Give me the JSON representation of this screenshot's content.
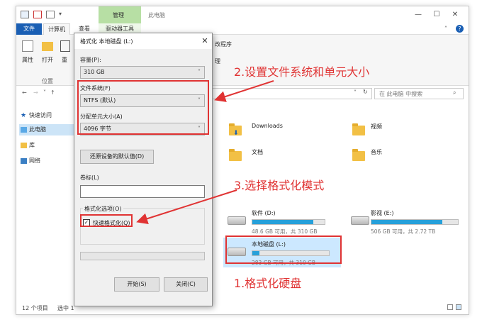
{
  "window": {
    "title": "此电脑",
    "context_tab_group": "管理",
    "controls": {
      "minimize": "—",
      "maximize": "☐",
      "close": "✕"
    }
  },
  "ribbon": {
    "tabs": [
      {
        "label": "文件"
      },
      {
        "label": "计算机"
      },
      {
        "label": "查看"
      },
      {
        "label": "驱动器工具"
      }
    ],
    "buttons": [
      {
        "label": "属性"
      },
      {
        "label": "打开"
      },
      {
        "label": "重"
      }
    ],
    "group_label": "位置",
    "partial_label": "改程序",
    "partial_label2": "理"
  },
  "address": {
    "nav": {
      "back": "←",
      "forward": "→",
      "down": "˅",
      "up": "↑"
    },
    "refresh": "↻",
    "search_placeholder": "在 此电脑 中搜索"
  },
  "nav_pane": {
    "items": [
      {
        "label": "快速访问"
      },
      {
        "label": "此电脑"
      },
      {
        "label": "库"
      },
      {
        "label": "网络"
      }
    ]
  },
  "folders": [
    {
      "label": "Downloads"
    },
    {
      "label": "视频"
    },
    {
      "label": "文档"
    },
    {
      "label": "音乐"
    }
  ],
  "drives": [
    {
      "name": "软件 (D:)",
      "free": "48.6 GB 可用，共 310 GB",
      "used_fraction": 0.84
    },
    {
      "name": "影视 (E:)",
      "free": "506 GB 可用，共 2.72 TB",
      "used_fraction": 0.82
    },
    {
      "name": "本地磁盘 (L:)",
      "free": "283 GB 可用，共 310 GB",
      "used_fraction": 0.09
    }
  ],
  "status": {
    "count": "12 个项目",
    "selected": "选中 1"
  },
  "dialog": {
    "title": "格式化 本地磁盘 (L:)",
    "close": "✕",
    "capacity_label": "容量(P):",
    "capacity_value": "310 GB",
    "filesystem_label": "文件系统(F)",
    "filesystem_value": "NTFS (默认)",
    "unit_label": "分配单元大小(A)",
    "unit_value": "4096 字节",
    "restore_button": "还原设备的默认值(D)",
    "volume_label": "卷标(L)",
    "volume_value": "",
    "options_label": "格式化选项(O)",
    "quick_format_label": "快速格式化(Q)",
    "quick_format_checked": "✓",
    "start_button": "开始(S)",
    "close_button": "关闭(C)"
  },
  "annotations": {
    "step1": "1.格式化硬盘",
    "step2": "2.设置文件系统和单元大小",
    "step3": "3.选择格式化模式"
  },
  "colors": {
    "annotation": "#e03333",
    "accent": "#1a5fb4",
    "bar": "#26a0da",
    "context_tab": "#b7dfa4"
  }
}
